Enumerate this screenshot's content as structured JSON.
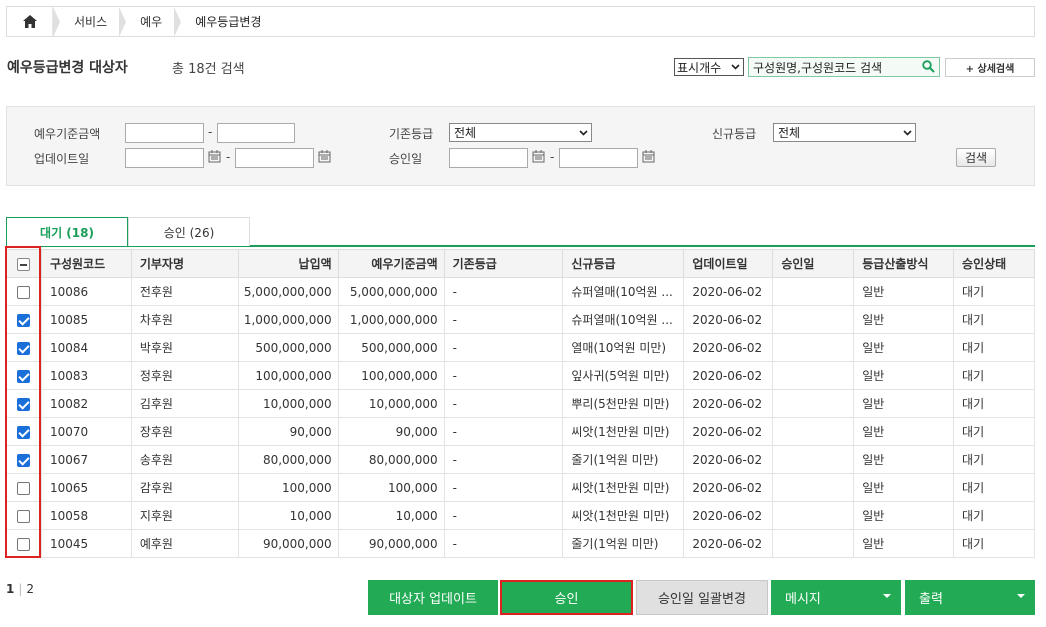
{
  "breadcrumb": {
    "items": [
      "서비스",
      "예우",
      "예우등급변경"
    ]
  },
  "header": {
    "title": "예우등급변경 대상자",
    "count": "총 18건 검색",
    "display_select": "표시개수",
    "search_placeholder": "구성원명,구성원코드 검색",
    "detail_search": "+ 상세검색"
  },
  "filter": {
    "amount_label": "예우기준금액",
    "update_label": "업데이트일",
    "prev_grade_label": "기존등급",
    "prev_grade_value": "전체",
    "approve_date_label": "승인일",
    "new_grade_label": "신규등급",
    "new_grade_value": "전체",
    "dash": "-",
    "search_button": "검색"
  },
  "tabs": [
    {
      "label": "대기 (18)"
    },
    {
      "label": "승인 (26)"
    }
  ],
  "table": {
    "headers": [
      "구성원코드",
      "기부자명",
      "납입액",
      "예우기준금액",
      "기존등급",
      "신규등급",
      "업데이트일",
      "승인일",
      "등급산출방식",
      "승인상태"
    ],
    "rows": [
      {
        "checked": false,
        "code": "10086",
        "name": "전후원",
        "paid": "5,000,000,000",
        "base": "5,000,000,000",
        "prev": "-",
        "new": "슈퍼열매(10억원 ...",
        "update": "2020-06-02",
        "approve": "",
        "method": "일반",
        "status": "대기"
      },
      {
        "checked": true,
        "code": "10085",
        "name": "차후원",
        "paid": "1,000,000,000",
        "base": "1,000,000,000",
        "prev": "-",
        "new": "슈퍼열매(10억원 ...",
        "update": "2020-06-02",
        "approve": "",
        "method": "일반",
        "status": "대기"
      },
      {
        "checked": true,
        "code": "10084",
        "name": "박후원",
        "paid": "500,000,000",
        "base": "500,000,000",
        "prev": "-",
        "new": "열매(10억원 미만)",
        "update": "2020-06-02",
        "approve": "",
        "method": "일반",
        "status": "대기"
      },
      {
        "checked": true,
        "code": "10083",
        "name": "정후원",
        "paid": "100,000,000",
        "base": "100,000,000",
        "prev": "-",
        "new": "잎사귀(5억원 미만)",
        "update": "2020-06-02",
        "approve": "",
        "method": "일반",
        "status": "대기"
      },
      {
        "checked": true,
        "code": "10082",
        "name": "김후원",
        "paid": "10,000,000",
        "base": "10,000,000",
        "prev": "-",
        "new": "뿌리(5천만원 미만)",
        "update": "2020-06-02",
        "approve": "",
        "method": "일반",
        "status": "대기"
      },
      {
        "checked": true,
        "code": "10070",
        "name": "장후원",
        "paid": "90,000",
        "base": "90,000",
        "prev": "-",
        "new": "씨앗(1천만원 미만)",
        "update": "2020-06-02",
        "approve": "",
        "method": "일반",
        "status": "대기"
      },
      {
        "checked": true,
        "code": "10067",
        "name": "송후원",
        "paid": "80,000,000",
        "base": "80,000,000",
        "prev": "-",
        "new": "줄기(1억원 미만)",
        "update": "2020-06-02",
        "approve": "",
        "method": "일반",
        "status": "대기"
      },
      {
        "checked": false,
        "code": "10065",
        "name": "감후원",
        "paid": "100,000",
        "base": "100,000",
        "prev": "-",
        "new": "씨앗(1천만원 미만)",
        "update": "2020-06-02",
        "approve": "",
        "method": "일반",
        "status": "대기"
      },
      {
        "checked": false,
        "code": "10058",
        "name": "지후원",
        "paid": "10,000",
        "base": "10,000",
        "prev": "-",
        "new": "씨앗(1천만원 미만)",
        "update": "2020-06-02",
        "approve": "",
        "method": "일반",
        "status": "대기"
      },
      {
        "checked": false,
        "code": "10045",
        "name": "예후원",
        "paid": "90,000,000",
        "base": "90,000,000",
        "prev": "-",
        "new": "줄기(1억원 미만)",
        "update": "2020-06-02",
        "approve": "",
        "method": "일반",
        "status": "대기"
      }
    ]
  },
  "pager": {
    "current": "1",
    "separator": "|",
    "next": "2"
  },
  "actions": {
    "update": "대상자 업데이트",
    "approve": "승인",
    "bulk_date": "승인일 일괄변경",
    "message": "메시지",
    "print": "출력"
  },
  "colors": {
    "accent": "#22aa55",
    "highlight": "#dd2222",
    "check": "#1a6fd8"
  }
}
